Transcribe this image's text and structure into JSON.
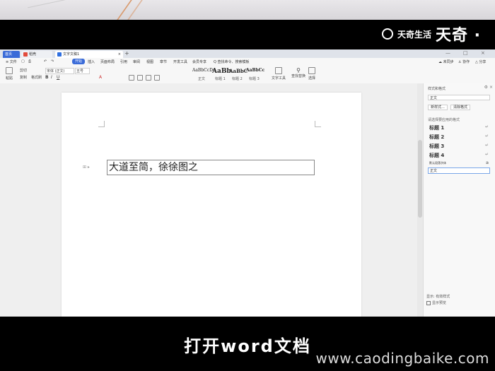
{
  "watermark": {
    "brand_cn": "天奇生活",
    "brand_big": "天奇 ·",
    "url": "www.caodingbaike.com"
  },
  "subtitle": "打开word文档",
  "app": {
    "tabs": [
      {
        "label": "首页"
      },
      {
        "label": "稻壳"
      },
      {
        "label": "文字文稿1"
      }
    ],
    "new_tab": "+",
    "window_controls": [
      "—",
      "□",
      "×"
    ],
    "menu": {
      "items": [
        "≡ 文件",
        "▢",
        "⎙",
        "↶",
        "↷",
        "开始",
        "插入",
        "页面布局",
        "引用",
        "审阅",
        "视图",
        "章节",
        "开发工具",
        "会员专享"
      ],
      "active_index": 5,
      "search": "Q 查找命令、搜索模板",
      "right": [
        "☁ 未同步",
        "♙ 协作",
        "△ 分享"
      ]
    },
    "ribbon": {
      "paste": "粘贴",
      "cut": "剪切",
      "copy": "复制",
      "format_painter": "格式刷",
      "font_name": "宋体 (正文)",
      "font_size": "五号",
      "styles": [
        {
          "preview": "AaBbCcDd",
          "label": "正文"
        },
        {
          "preview": "AaBb",
          "label": "标题 1"
        },
        {
          "preview": "AaBbC",
          "label": "标题 2"
        },
        {
          "preview": "AaBbCc",
          "label": "标题 3"
        }
      ],
      "text_tools": "文字工具",
      "find_replace": "查找替换",
      "select": "选择"
    },
    "document": {
      "text": "大道至简，徐徐图之"
    },
    "style_panel": {
      "title": "样式和格式",
      "current": "正文",
      "new_style": "新样式...",
      "clear_format": "清除格式",
      "section_label": "请选择要应用的格式",
      "headings": [
        "标题 1",
        "标题 2",
        "标题 3",
        "标题 4"
      ],
      "default_para": "默认段落字体",
      "selected": "正文",
      "show_label": "显示: 有效样式",
      "preview_label": "显示预览"
    }
  }
}
